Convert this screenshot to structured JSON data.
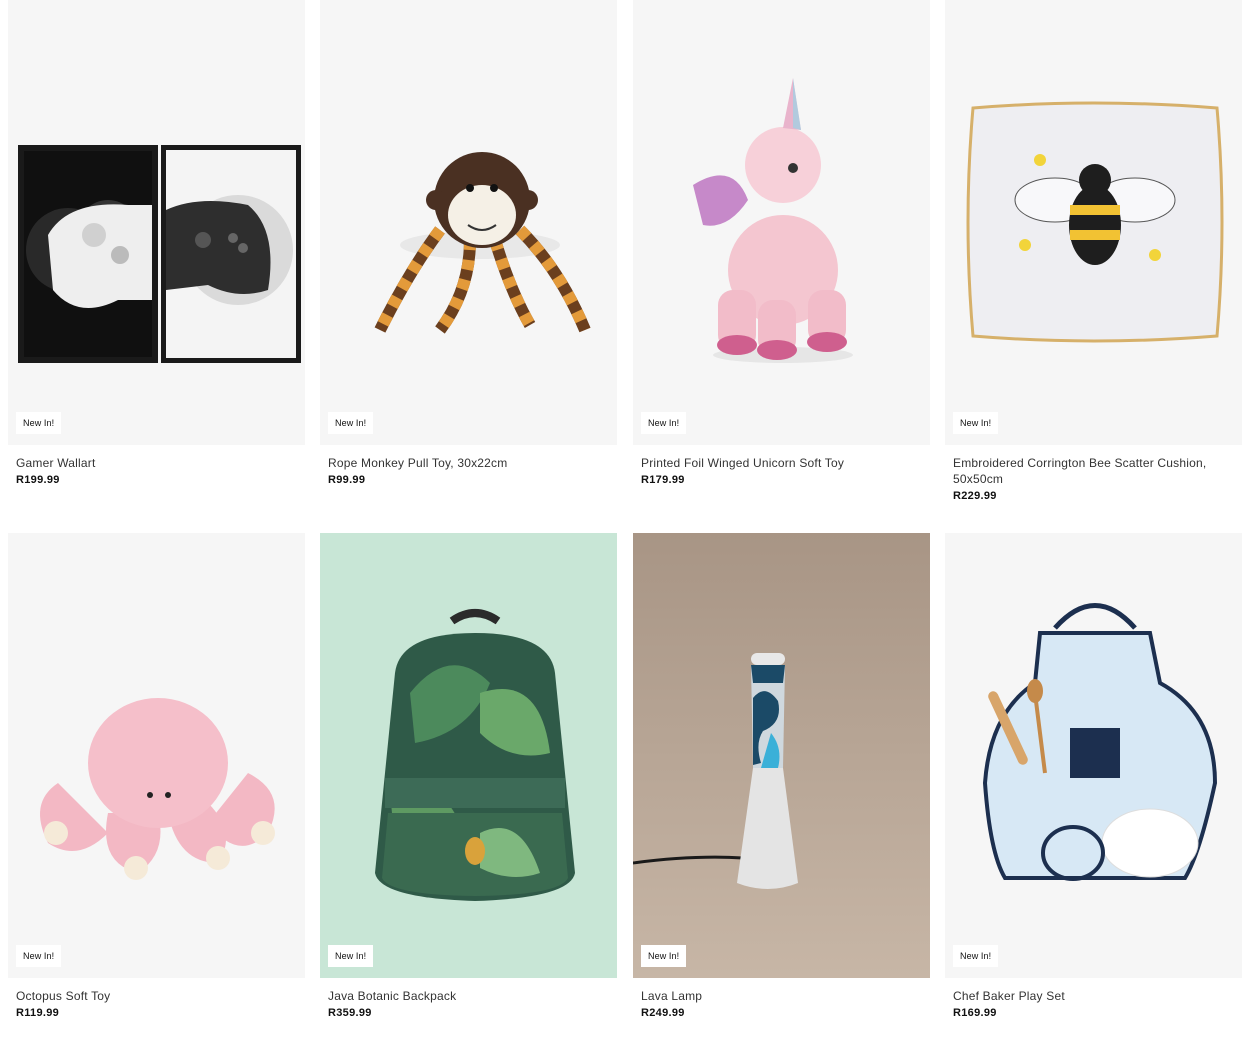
{
  "products": [
    {
      "name": "Gamer Wallart",
      "price": "R199.99",
      "badge": "New In!",
      "image": "gamer-wallart-image",
      "bg": "#f6f6f6"
    },
    {
      "name": "Rope Monkey Pull Toy, 30x22cm",
      "price": "R99.99",
      "badge": "New In!",
      "image": "monkey-toy-image",
      "bg": "#f6f6f6"
    },
    {
      "name": "Printed Foil Winged Unicorn Soft Toy",
      "price": "R179.99",
      "badge": "New In!",
      "image": "unicorn-toy-image",
      "bg": "#f6f6f6"
    },
    {
      "name": "Embroidered Corrington Bee Scatter Cushion, 50x50cm",
      "price": "R229.99",
      "badge": "New In!",
      "image": "bee-cushion-image",
      "bg": "#f6f6f6"
    },
    {
      "name": "Octopus Soft Toy",
      "price": "R119.99",
      "badge": "New In!",
      "image": "octopus-toy-image",
      "bg": "#f6f6f6"
    },
    {
      "name": "Java Botanic Backpack",
      "price": "R359.99",
      "badge": "New In!",
      "image": "backpack-image",
      "bg": "#c8e6d6"
    },
    {
      "name": "Lava Lamp",
      "price": "R249.99",
      "badge": "New In!",
      "image": "lava-lamp-image",
      "bg": "#b39e8c"
    },
    {
      "name": "Chef Baker Play Set",
      "price": "R169.99",
      "badge": "New In!",
      "image": "chef-set-image",
      "bg": "#f6f6f6"
    }
  ]
}
